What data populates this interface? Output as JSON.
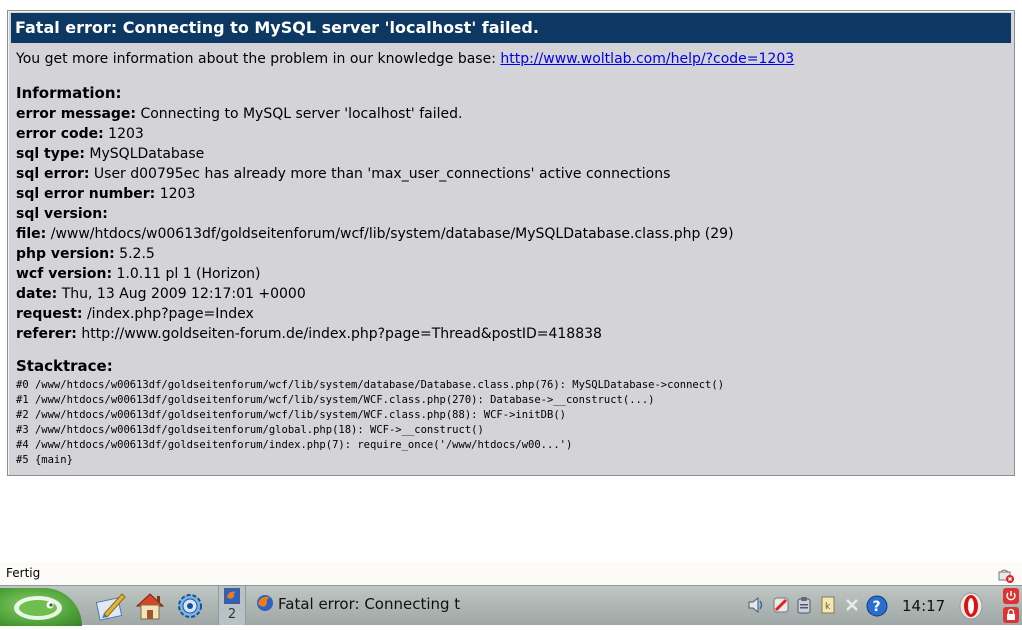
{
  "error": {
    "title": "Fatal error: Connecting to MySQL server 'localhost' failed.",
    "kb_prefix": "You get more information about the problem in our knowledge base: ",
    "kb_link": "http://www.woltlab.com/help/?code=1203",
    "information_heading": "Information:",
    "info": [
      {
        "label": "error message:",
        "value": " Connecting to MySQL server 'localhost' failed."
      },
      {
        "label": "error code:",
        "value": " 1203"
      },
      {
        "label": "sql type:",
        "value": " MySQLDatabase"
      },
      {
        "label": "sql error:",
        "value": " User d00795ec has already more than 'max_user_connections' active connections"
      },
      {
        "label": "sql error number:",
        "value": " 1203"
      },
      {
        "label": "sql version:",
        "value": ""
      },
      {
        "label": "file:",
        "value": " /www/htdocs/w00613df/goldseitenforum/wcf/lib/system/database/MySQLDatabase.class.php (29)"
      },
      {
        "label": "php version:",
        "value": " 5.2.5"
      },
      {
        "label": "wcf version:",
        "value": " 1.0.11 pl 1 (Horizon)"
      },
      {
        "label": "date:",
        "value": " Thu, 13 Aug 2009 12:17:01 +0000"
      },
      {
        "label": "request:",
        "value": " /index.php?page=Index"
      },
      {
        "label": "referer:",
        "value": " http://www.goldseiten-forum.de/index.php?page=Thread&postID=418838"
      }
    ],
    "stacktrace_heading": "Stacktrace:",
    "stacktrace": [
      "#0 /www/htdocs/w00613df/goldseitenforum/wcf/lib/system/database/Database.class.php(76): MySQLDatabase->connect()",
      "#1 /www/htdocs/w00613df/goldseitenforum/wcf/lib/system/WCF.class.php(270): Database->__construct(...)",
      "#2 /www/htdocs/w00613df/goldseitenforum/wcf/lib/system/WCF.class.php(88): WCF->initDB()",
      "#3 /www/htdocs/w00613df/goldseitenforum/global.php(18): WCF->__construct()",
      "#4 /www/htdocs/w00613df/goldseitenforum/index.php(7): require_once('/www/htdocs/w00...')",
      "#5 {main}"
    ]
  },
  "statusbar": {
    "text": "Fertig"
  },
  "panel": {
    "pager_number": "2",
    "task_label": "Fatal error: Connecting to MySQL server 'localhost' failed.",
    "clock": "14:17"
  },
  "colors": {
    "header_bg": "#0c3863",
    "box_bg": "#d4d3d8",
    "link": "#0000ee"
  }
}
